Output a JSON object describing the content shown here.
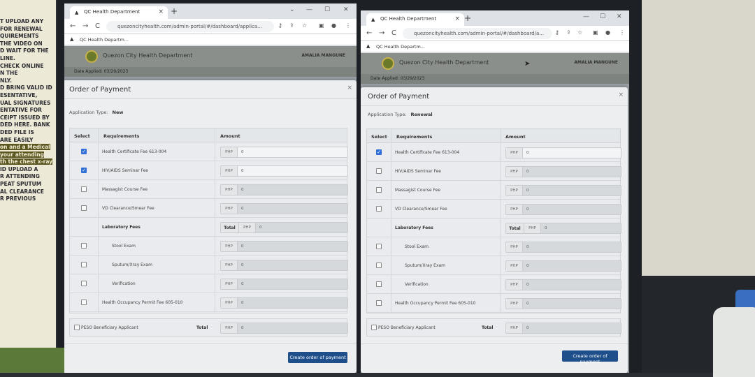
{
  "sticky_note": {
    "lines": [
      "T UPLOAD ANY",
      "FOR RENEWAL",
      "QUIREMENTS",
      "THE VIDEO ON",
      "D WAIT FOR THE",
      "",
      "LINE.",
      "",
      "",
      "CHECK ONLINE",
      "N THE",
      "NLY.",
      "",
      "D BRING VALID ID",
      "ESENTATIVE,",
      "UAL SIGNATURES",
      "ENTATIVE FOR",
      "",
      "",
      "",
      "CEIPT ISSUED BY",
      "DED HERE. BANK",
      "",
      "",
      "DED FILE IS",
      "ARE EASILY",
      "",
      "on and a Medical",
      "your attending",
      "th the chest x-ray",
      "",
      "",
      "ID UPLOAD A",
      "R ATTENDING",
      "",
      "",
      "PEAT SPUTUM",
      "AL CLEARANCE",
      "",
      "",
      "R PREVIOUS"
    ],
    "highlight_lines": [
      27,
      28,
      29
    ]
  },
  "browser": {
    "tab_title": "QC Health Department",
    "url": "quezoncityhealth.com/admin-portal/#/dashboard/applica...",
    "url_right": "quezoncityhealth.com/admin-portal/#/dashboard/a...",
    "bookmark": "QC Health Departm..."
  },
  "site": {
    "title": "Quezon City Health Department",
    "user": "AMALIA MANGUNE",
    "subbar": "Date Applied:  03/29/2023"
  },
  "modal": {
    "title": "Order of Payment",
    "app_type_label": "Application Type:",
    "headers": {
      "select": "Select",
      "requirements": "Requirements",
      "amount": "Amount"
    },
    "currency": "PHP",
    "total_label": "Total",
    "peso_label": "PESO Beneficiary Applicant",
    "create_button": "Create order of payment",
    "lab_fees_label": "Laboratory Fees",
    "rows": [
      {
        "name": "Health Certificate Fee 613-004",
        "value": "0"
      },
      {
        "name": "HIV/AIDS Seminar Fee",
        "value": "0"
      },
      {
        "name": "Massagist Course Fee",
        "value": "0"
      },
      {
        "name": "VD Clearance/Smear Fee",
        "value": "0"
      },
      {
        "name": "Stool Exam",
        "value": "0"
      },
      {
        "name": "Sputum/Xray Exam",
        "value": "0"
      },
      {
        "name": "Verification",
        "value": "0"
      },
      {
        "name": "Health Occupancy Permit Fee 605-010",
        "value": "0"
      }
    ],
    "lab_total_value": "0",
    "grand_total_value": "0"
  },
  "left_window": {
    "application_type": "New",
    "checked": [
      true,
      true,
      false,
      false,
      false,
      false,
      false,
      false
    ]
  },
  "right_window": {
    "application_type": "Renewal",
    "checked": [
      true,
      false,
      false,
      false,
      false,
      false,
      false,
      false
    ]
  },
  "colors": {
    "accent": "#1f4f8a",
    "checkbox": "#2f6fd6"
  }
}
